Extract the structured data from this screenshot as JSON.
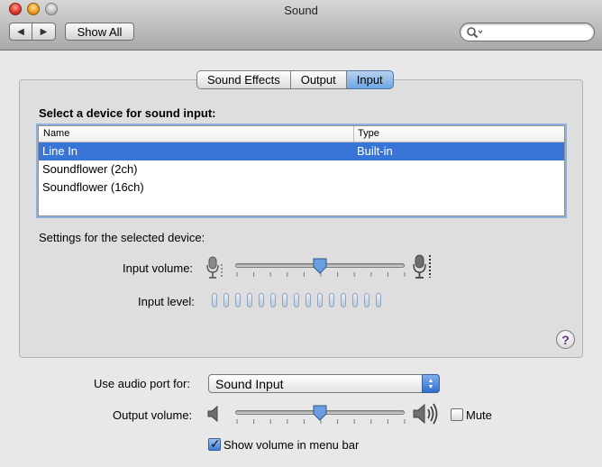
{
  "window": {
    "title": "Sound"
  },
  "toolbar": {
    "back_label": "◀",
    "forward_label": "▶",
    "show_all_label": "Show All",
    "search_placeholder": ""
  },
  "tabs": [
    {
      "label": "Sound Effects",
      "active": false
    },
    {
      "label": "Output",
      "active": false
    },
    {
      "label": "Input",
      "active": true
    }
  ],
  "input": {
    "device_prompt": "Select a device for sound input:",
    "columns": [
      "Name",
      "Type"
    ],
    "devices": [
      {
        "name": "Line In",
        "type": "Built-in",
        "selected": true
      },
      {
        "name": "Soundflower (2ch)",
        "type": "",
        "selected": false
      },
      {
        "name": "Soundflower (16ch)",
        "type": "",
        "selected": false
      }
    ],
    "settings_label": "Settings for the selected device:",
    "input_volume_label": "Input volume:",
    "input_volume_fraction": 0.5,
    "input_level_label": "Input level:",
    "input_level_segments": 15,
    "help_label": "?"
  },
  "bottom": {
    "audio_port_label": "Use audio port for:",
    "audio_port_value": "Sound Input",
    "output_volume_label": "Output volume:",
    "output_volume_fraction": 0.5,
    "mute_label": "Mute",
    "mute_checked": false,
    "show_volume_label": "Show volume in menu bar",
    "show_volume_checked": true
  },
  "colors": {
    "selection": "#3875d7",
    "accent": "#6da5e2"
  }
}
